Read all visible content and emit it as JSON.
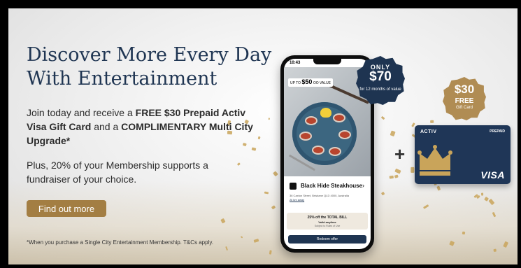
{
  "headline": {
    "line1": "Discover More Every Day",
    "line2": "With Entertainment"
  },
  "lead": {
    "p1": "Join today and receive a ",
    "b1": "FREE $30 Prepaid Activ Visa Gift Card",
    "p2": " and a ",
    "b2": "COMPLIMENTARY Multi City Upgrade*"
  },
  "para2": "Plus, 20% of your Membership supports a fundraiser of your choice.",
  "cta": {
    "label": "Find out more"
  },
  "footnote": "*When you purchase a Single City Entertainment Membership. T&Cs apply.",
  "phone": {
    "time": "10:43",
    "value_badge": {
      "prefix": "UP TO",
      "amount": "$50",
      "suffix": "OO VALUE"
    },
    "venue_name": "Black Hide Steakhouse",
    "address": "36 Caxton Street, Brisbane QLD 4000, Australia",
    "distance": "2k km away",
    "offer_title": "25% off the TOTAL BILL",
    "offer_sub": "Valid anytime",
    "offer_terms": "Subject to Rules of Use",
    "redeem_label": "Redeem offer"
  },
  "price_badge": {
    "line1": "ONLY",
    "price": "$70",
    "line3": "for 12 months of value",
    "color": "#1e3451"
  },
  "gift_badge": {
    "amount": "$30",
    "line2": "FREE",
    "line3": "Gift Card",
    "color": "#b08c53"
  },
  "plus_symbol": "+",
  "card": {
    "brand": "ACTIV",
    "type": "PREPAID",
    "network": "VISA",
    "icon": "crown-icon",
    "color": "#1f3657"
  },
  "colors": {
    "headline": "#1f3552",
    "cta": "#a37e43",
    "gold": "#c9a45a"
  }
}
